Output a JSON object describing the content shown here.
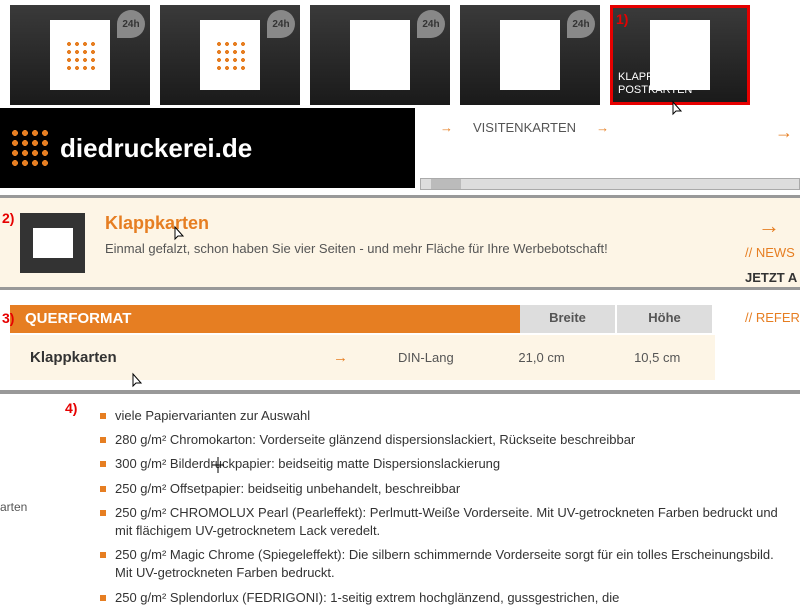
{
  "tiles": {
    "badge": "24h",
    "selected_num": "1)",
    "label_line1": "KLAPP-/",
    "label_line2": "POSTKARTEN"
  },
  "nav": {
    "visitenkarten": "VISITENKARTEN"
  },
  "logo": {
    "text": "diedruckerei.de"
  },
  "panel2": {
    "num": "2)",
    "title": "Klappkarten",
    "desc": "Einmal gefalzt, schon haben Sie vier Seiten - und mehr Fläche für Ihre Werbebotschaft!"
  },
  "side": {
    "news": "// NEWS",
    "jetzt": "JETZT A",
    "refer": "// REFER"
  },
  "section3": {
    "num": "3)",
    "header": "QUERFORMAT",
    "col_breite": "Breite",
    "col_hoehe": "Höhe",
    "row_name": "Klappkarten",
    "row_format": "DIN-Lang",
    "row_breite": "21,0 cm",
    "row_hoehe": "10,5 cm"
  },
  "section4": {
    "num": "4)",
    "items": [
      "viele Papiervarianten zur Auswahl",
      "280 g/m² Chromokarton: Vorderseite glänzend dispersionslackiert, Rückseite beschreibbar",
      "300 g/m² Bilderdruckpapier: beidseitig matte Dispersionslackierung",
      "250 g/m² Offsetpapier: beidseitig unbehandelt, beschreibbar",
      "250 g/m² CHROMOLUX Pearl (Pearleffekt): Perlmutt-Weiße Vorderseite. Mit UV-getrockneten Farben bedruckt und mit flächigem UV-getrocknetem Lack veredelt.",
      "250 g/m² Magic Chrome (Spiegeleffekt): Die silbern schimmernde Vorderseite sorgt für ein tolles Erscheinungsbild. Mit UV-getrockneten Farben bedruckt.",
      "250 g/m² Splendorlux (FEDRIGONI): 1-seitig extrem hochglänzend, gussgestrichen, die"
    ]
  },
  "side_frag": "arten"
}
